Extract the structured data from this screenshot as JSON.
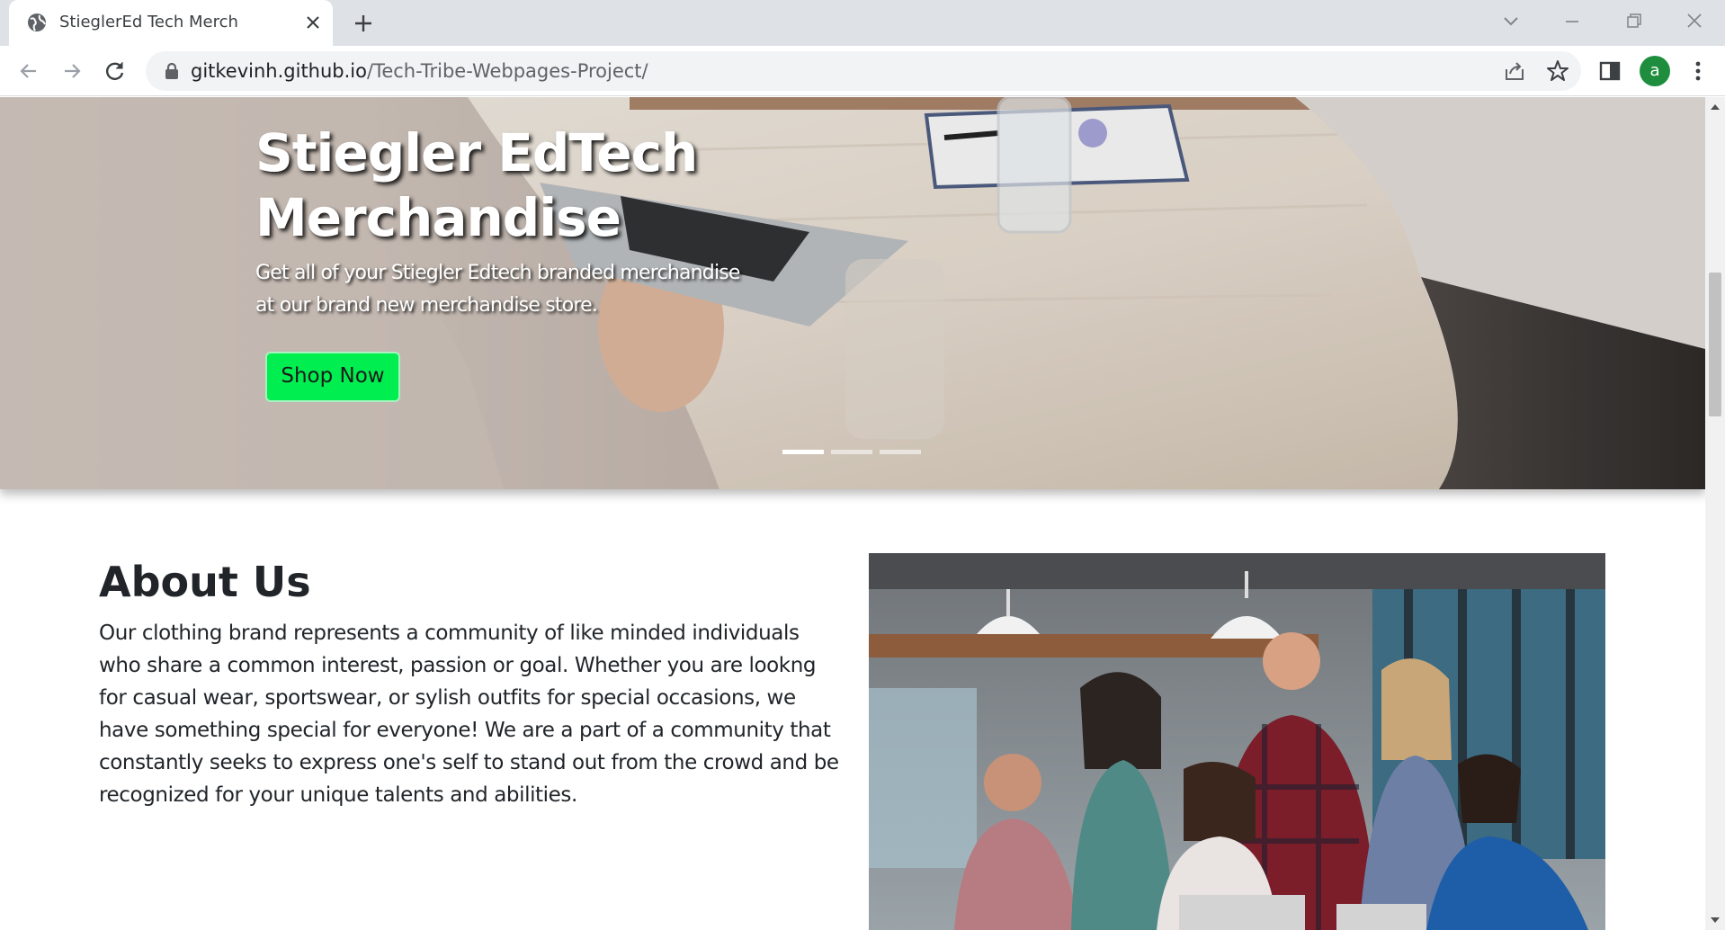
{
  "browser": {
    "tab_title": "StieglerEd Tech Merch",
    "url_host": "gitkevinh.github.io",
    "url_path": "/Tech-Tribe-Webpages-Project/",
    "profile_initial": "a"
  },
  "hero": {
    "title_line1": "Stiegler EdTech",
    "title_line2": "Merchandise",
    "subtitle_line1": "Get all of your Stiegler Edtech branded merchandise",
    "subtitle_line2": "at our brand new merchandise store.",
    "cta_label": "Shop Now",
    "carousel_slide_count": 3,
    "carousel_active_index": 0
  },
  "about": {
    "title": "About Us",
    "body": "Our clothing brand represents a community of like minded individuals who share a common interest, passion or goal. Whether you are lookng for casual wear, sportswear, or sylish outfits for special occasions, we have something special for everyone! We are a part of a community that constantly seeks to express one's self to stand out from the crowd and be recognized for your unique talents and abilities."
  },
  "colors": {
    "cta": "#00ee4f",
    "avatar": "#1e8e3e",
    "text": "#212529"
  }
}
